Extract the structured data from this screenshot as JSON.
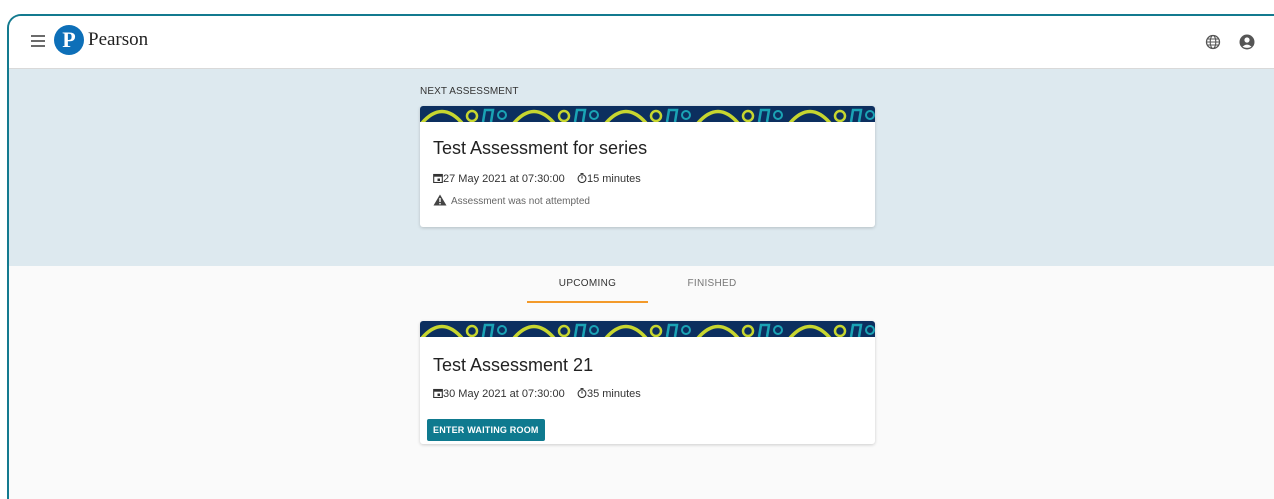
{
  "header": {
    "brand_initial": "P",
    "brand_name": "Pearson",
    "menu_icon": "hamburger-icon",
    "language_icon": "globe-icon",
    "account_icon": "account-icon"
  },
  "next_assessment": {
    "section_label": "NEXT ASSESSMENT",
    "title": "Test Assessment for series",
    "date": "27 May 2021 at 07:30:00",
    "duration": "15 minutes",
    "status": "Assessment was not attempted"
  },
  "tabs": [
    {
      "label": "UPCOMING",
      "active": true
    },
    {
      "label": "FINISHED",
      "active": false
    }
  ],
  "upcoming": [
    {
      "title": "Test Assessment 21",
      "date": "30 May 2021 at 07:30:00",
      "duration": "35 minutes",
      "action_label": "ENTER WAITING ROOM"
    }
  ],
  "colors": {
    "frame": "#137a8f",
    "hero_bg": "#dde9ef",
    "accent_tab": "#f39a2a",
    "button": "#0f7a8f",
    "banner_navy": "#0c2f5f",
    "banner_lime": "#c7d62f",
    "banner_teal": "#1aa3b5"
  }
}
